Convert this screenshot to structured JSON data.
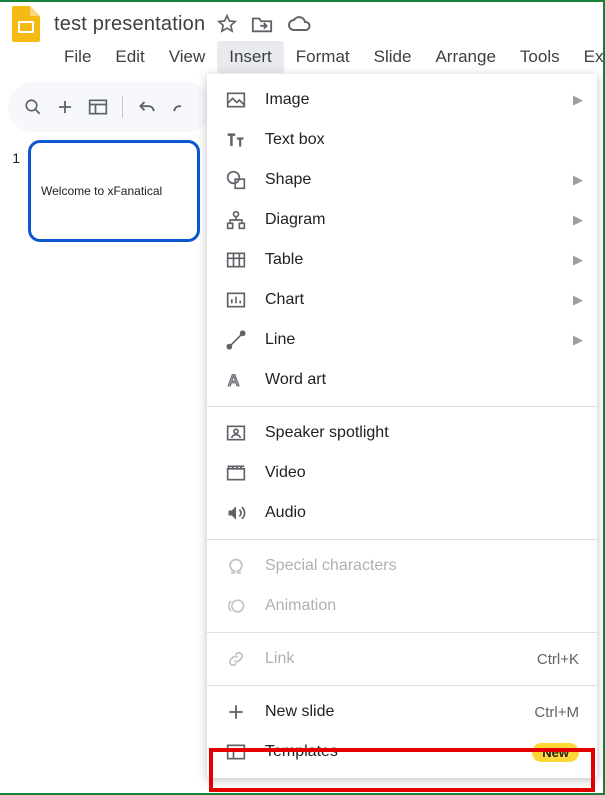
{
  "header": {
    "title": "test presentation"
  },
  "menubar": {
    "items": [
      "File",
      "Edit",
      "View",
      "Insert",
      "Format",
      "Slide",
      "Arrange",
      "Tools",
      "Exte"
    ],
    "active_index": 3
  },
  "slides": [
    {
      "number": "1",
      "text": "Welcome to xFanatical"
    }
  ],
  "insert_menu": {
    "groups": [
      [
        {
          "label": "Image",
          "icon": "image-icon",
          "submenu": true
        },
        {
          "label": "Text box",
          "icon": "textbox-icon"
        },
        {
          "label": "Shape",
          "icon": "shape-icon",
          "submenu": true
        },
        {
          "label": "Diagram",
          "icon": "diagram-icon",
          "submenu": true
        },
        {
          "label": "Table",
          "icon": "table-icon",
          "submenu": true
        },
        {
          "label": "Chart",
          "icon": "chart-icon",
          "submenu": true
        },
        {
          "label": "Line",
          "icon": "line-icon",
          "submenu": true
        },
        {
          "label": "Word art",
          "icon": "wordart-icon"
        }
      ],
      [
        {
          "label": "Speaker spotlight",
          "icon": "speaker-spotlight-icon"
        },
        {
          "label": "Video",
          "icon": "video-icon"
        },
        {
          "label": "Audio",
          "icon": "audio-icon"
        }
      ],
      [
        {
          "label": "Special characters",
          "icon": "omega-icon",
          "disabled": true
        },
        {
          "label": "Animation",
          "icon": "animation-icon",
          "disabled": true
        }
      ],
      [
        {
          "label": "Link",
          "icon": "link-icon",
          "disabled": true,
          "shortcut": "Ctrl+K"
        }
      ],
      [
        {
          "label": "New slide",
          "icon": "plus-icon",
          "shortcut": "Ctrl+M"
        },
        {
          "label": "Templates",
          "icon": "templates-icon",
          "badge": "New",
          "highlight": true
        }
      ]
    ]
  }
}
